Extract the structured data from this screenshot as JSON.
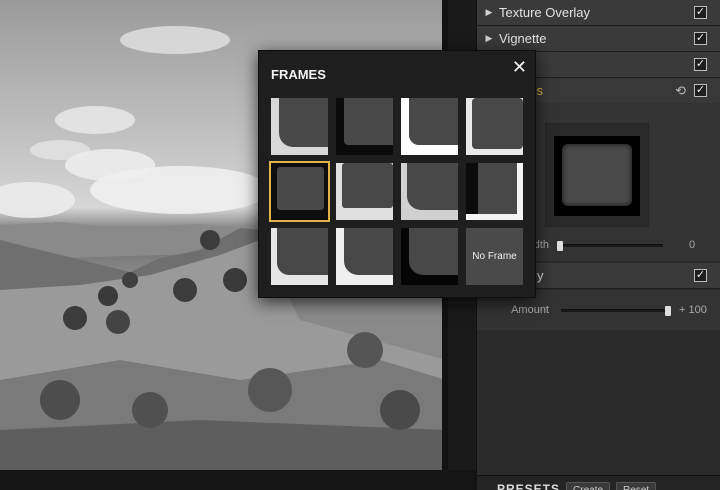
{
  "panel": {
    "sections": [
      {
        "label": "Texture Overlay",
        "checked": true
      },
      {
        "label": "Vignette",
        "checked": true
      },
      {
        "label": "",
        "checked": true
      },
      {
        "label": "Frames",
        "checked": true,
        "active": true
      }
    ],
    "frames": {
      "width_label": "Width",
      "width_value": "0",
      "width_fraction": 0.0
    },
    "detail_row": {
      "label": "y",
      "checked": true
    },
    "amount": {
      "label": "Amount",
      "value": "+ 100",
      "fraction": 1.0
    },
    "presets": {
      "title": "PRESETS",
      "create_label": "Create",
      "reset_label": "Reset"
    }
  },
  "popup": {
    "title": "FRAMES",
    "close_label": "✕",
    "no_frame_label": "No Frame",
    "frames": [
      {
        "style": "light-corner"
      },
      {
        "style": "dark-grunge"
      },
      {
        "style": "white-corner"
      },
      {
        "style": "white-rough"
      },
      {
        "style": "dark-rough",
        "selected": true
      },
      {
        "style": "white-bottom-grunge"
      },
      {
        "style": "white-brush"
      },
      {
        "style": "black-white-edge"
      },
      {
        "style": "white-soft"
      },
      {
        "style": "white-wide"
      },
      {
        "style": "black-corner"
      },
      {
        "style": "none"
      }
    ]
  },
  "icons": {
    "expand": "▶",
    "check": "✓",
    "refresh": "⟲",
    "accent": "#e8b74a"
  }
}
